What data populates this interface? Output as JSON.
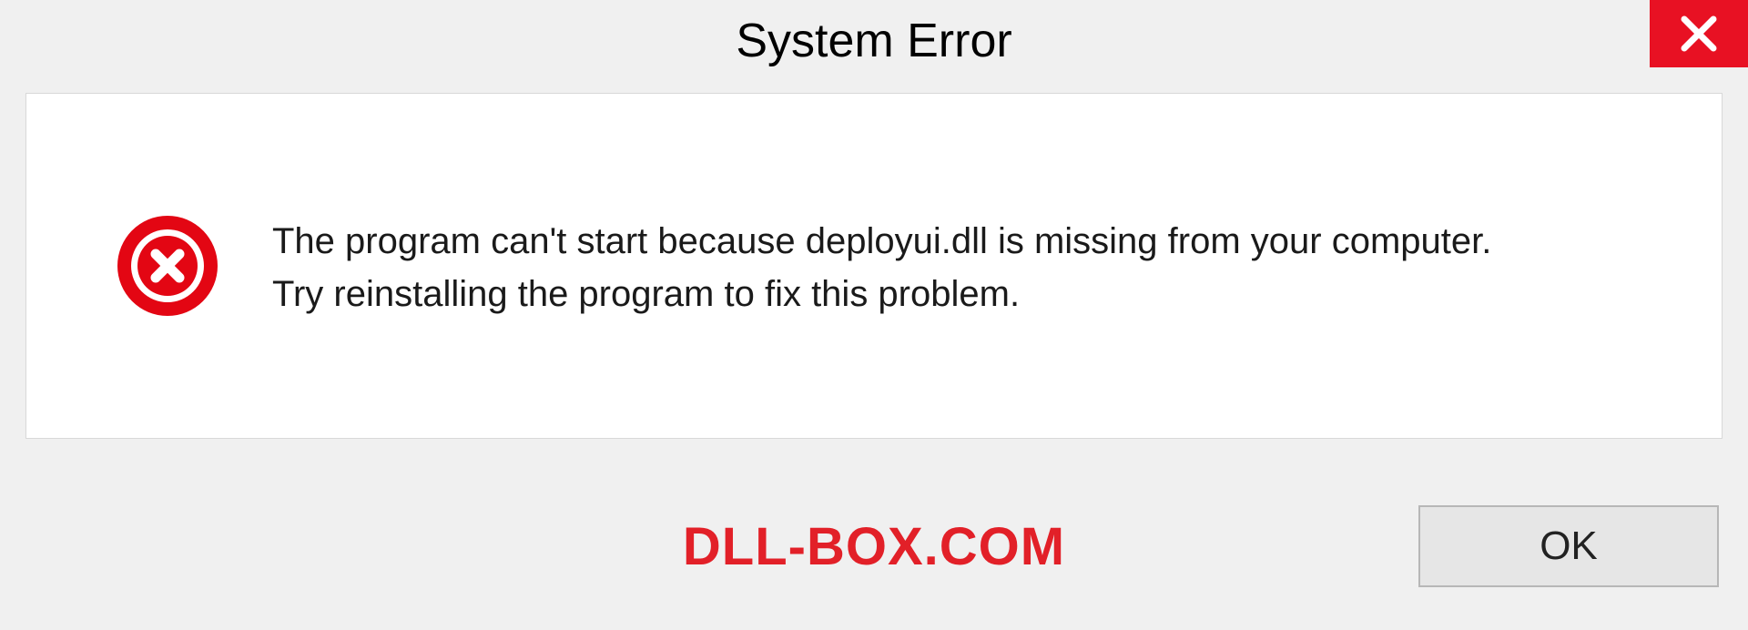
{
  "dialog": {
    "title": "System Error",
    "message_line1": "The program can't start because deployui.dll is missing from your computer.",
    "message_line2": "Try reinstalling the program to fix this problem.",
    "ok_label": "OK"
  },
  "watermark": "DLL-BOX.COM",
  "colors": {
    "close_bg": "#e81123",
    "error_icon": "#e30613",
    "watermark": "#e22028"
  }
}
